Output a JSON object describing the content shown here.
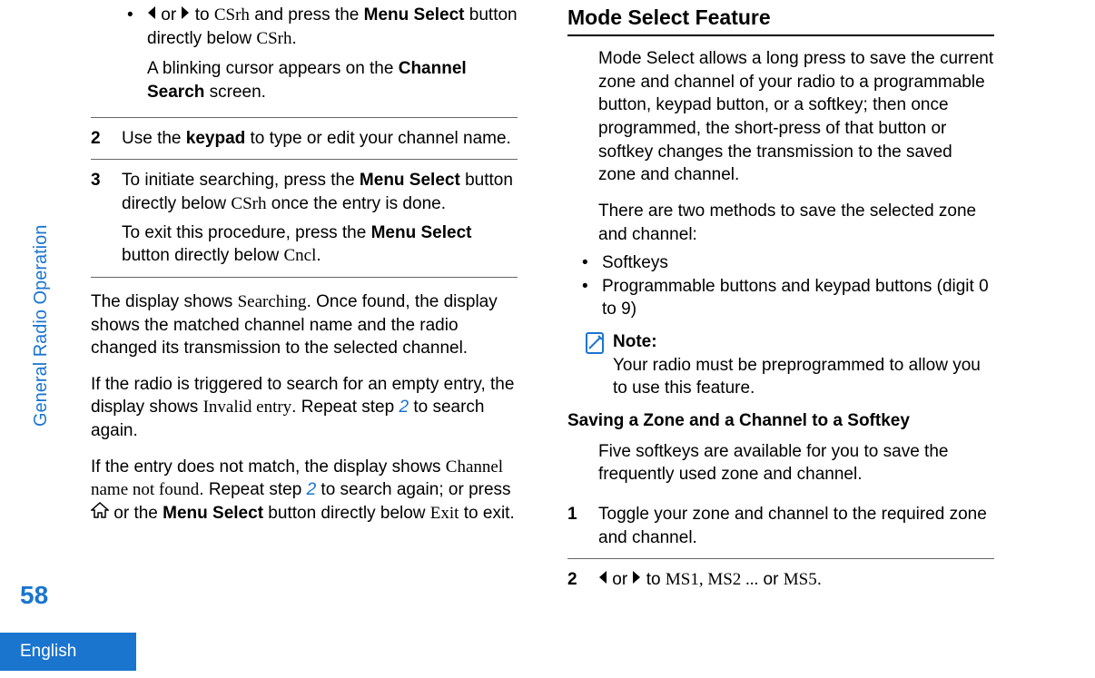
{
  "sidebar": {
    "section_label": "General Radio Operation",
    "page_number": "58",
    "language": "English"
  },
  "left": {
    "bullet_pre": " or ",
    "bullet_mid": " to ",
    "bullet_csrh": "CSrh",
    "bullet_post1": " and press the ",
    "bullet_menuselect": "Menu Select",
    "bullet_post2": " button directly below ",
    "bullet_period": ".",
    "step1_para2a": "A blinking cursor appears on the ",
    "step1_channelsearch": "Channel Search",
    "step1_para2b": " screen.",
    "step2_num": "2",
    "step2_a": "Use the ",
    "step2_keypad": "keypad",
    "step2_b": " to type or edit your channel name.",
    "step3_num": "3",
    "step3_a": "To initiate searching, press the ",
    "step3_menuselect": "Menu Select",
    "step3_b": " button directly below ",
    "step3_csrh": "CSrh",
    "step3_c": " once the entry is done.",
    "step3_d": "To exit this procedure, press the ",
    "step3_e": " button directly below ",
    "step3_cncl": "Cncl",
    "step3_period": ".",
    "p4a": "The display shows ",
    "p4_searching": "Searching",
    "p4b": ". Once found, the display shows the matched channel name and the radio changed its transmission to the selected channel.",
    "p5a": "If the radio is triggered to search for an empty entry, the display shows ",
    "p5_invalid": "Invalid entry",
    "p5b": ". Repeat step ",
    "p5_link": "2",
    "p5c": " to search again.",
    "p6a": "If the entry does not match, the display shows ",
    "p6_cnf": "Channel name not found",
    "p6b": ". Repeat step ",
    "p6_link": "2",
    "p6c": " to search again; or press ",
    "p6d": " or the ",
    "p6_menuselect": "Menu Select",
    "p6e": " button directly below ",
    "p6_exit": "Exit",
    "p6f": " to exit."
  },
  "right": {
    "h2": "Mode Select Feature",
    "intro1": "Mode Select allows a long press to save the current zone and channel of your radio to a programmable button, keypad button, or a softkey; then once programmed, the short-press of that button or softkey changes the transmission to the saved zone and channel.",
    "intro2": "There are two methods to save the selected zone and channel:",
    "li1": "Softkeys",
    "li2": "Programmable buttons and keypad buttons (digit 0 to 9)",
    "note_label": "Note:",
    "note_text": "Your radio must be preprogrammed to allow you to use this feature.",
    "h3": "Saving a Zone and a Channel to a Softkey",
    "sk_intro": "Five softkeys are available for you to save the frequently used zone and channel.",
    "s1_num": "1",
    "s1_text": "Toggle your zone and channel to the required zone and channel.",
    "s2_num": "2",
    "s2_or": " or ",
    "s2_to": " to ",
    "s2_ms": "MS1, MS2 ...",
    "s2_or2": " or ",
    "s2_ms5": "MS5",
    "s2_period": "."
  },
  "icons": {
    "bullet_dot": "•"
  }
}
